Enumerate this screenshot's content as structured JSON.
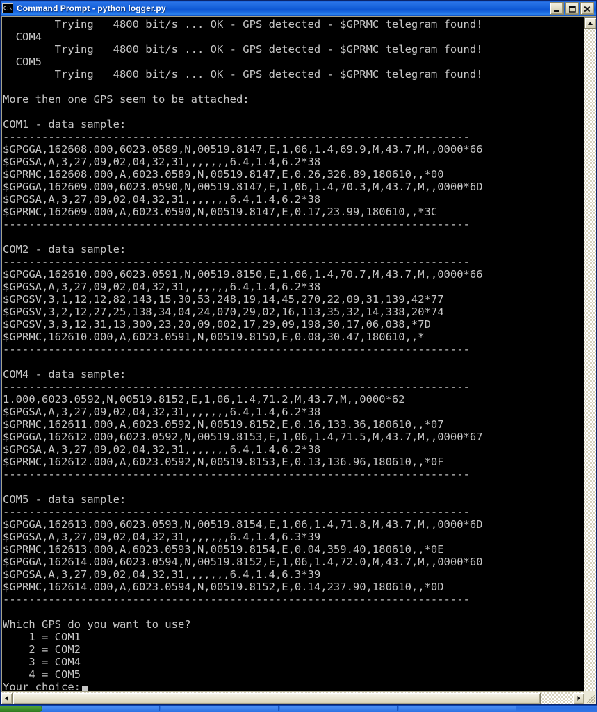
{
  "window": {
    "title": "Command Prompt - python logger.py",
    "icon_name": "cmd-console-icon",
    "icon_glyph": "C:\\",
    "minimize_label": "Minimize",
    "maximize_label": "Maximize",
    "close_label": "Close"
  },
  "scrollbars": {
    "v_up_label": "Scroll up",
    "v_down_label": "Scroll down",
    "h_left_label": "Scroll left",
    "h_right_label": "Scroll right"
  },
  "console": {
    "separator": "------------------------------------------------------------------------",
    "prompt_cursor": "block",
    "lines": [
      "        Trying   4800 bit/s ... OK - GPS detected - $GPRMC telegram found!",
      "  COM4",
      "        Trying   4800 bit/s ... OK - GPS detected - $GPRMC telegram found!",
      "  COM5",
      "        Trying   4800 bit/s ... OK - GPS detected - $GPRMC telegram found!",
      "",
      "More then one GPS seem to be attached:",
      "",
      "COM1 - data sample:",
      "------------------------------------------------------------------------",
      "$GPGGA,162608.000,6023.0589,N,00519.8147,E,1,06,1.4,69.9,M,43.7,M,,0000*66",
      "$GPGSA,A,3,27,09,02,04,32,31,,,,,,,6.4,1.4,6.2*38",
      "$GPRMC,162608.000,A,6023.0589,N,00519.8147,E,0.26,326.89,180610,,*00",
      "$GPGGA,162609.000,6023.0590,N,00519.8147,E,1,06,1.4,70.3,M,43.7,M,,0000*6D",
      "$GPGSA,A,3,27,09,02,04,32,31,,,,,,,6.4,1.4,6.2*38",
      "$GPRMC,162609.000,A,6023.0590,N,00519.8147,E,0.17,23.99,180610,,*3C",
      "------------------------------------------------------------------------",
      "",
      "COM2 - data sample:",
      "------------------------------------------------------------------------",
      "$GPGGA,162610.000,6023.0591,N,00519.8150,E,1,06,1.4,70.7,M,43.7,M,,0000*66",
      "$GPGSA,A,3,27,09,02,04,32,31,,,,,,,6.4,1.4,6.2*38",
      "$GPGSV,3,1,12,12,82,143,15,30,53,248,19,14,45,270,22,09,31,139,42*77",
      "$GPGSV,3,2,12,27,25,138,34,04,24,070,29,02,16,113,35,32,14,338,20*74",
      "$GPGSV,3,3,12,31,13,300,23,20,09,002,17,29,09,198,30,17,06,038,*7D",
      "$GPRMC,162610.000,A,6023.0591,N,00519.8150,E,0.08,30.47,180610,,*",
      "------------------------------------------------------------------------",
      "",
      "COM4 - data sample:",
      "------------------------------------------------------------------------",
      "1.000,6023.0592,N,00519.8152,E,1,06,1.4,71.2,M,43.7,M,,0000*62",
      "$GPGSA,A,3,27,09,02,04,32,31,,,,,,,6.4,1.4,6.2*38",
      "$GPRMC,162611.000,A,6023.0592,N,00519.8152,E,0.16,133.36,180610,,*07",
      "$GPGGA,162612.000,6023.0592,N,00519.8153,E,1,06,1.4,71.5,M,43.7,M,,0000*67",
      "$GPGSA,A,3,27,09,02,04,32,31,,,,,,,6.4,1.4,6.2*38",
      "$GPRMC,162612.000,A,6023.0592,N,00519.8153,E,0.13,136.96,180610,,*0F",
      "------------------------------------------------------------------------",
      "",
      "COM5 - data sample:",
      "------------------------------------------------------------------------",
      "$GPGGA,162613.000,6023.0593,N,00519.8154,E,1,06,1.4,71.8,M,43.7,M,,0000*6D",
      "$GPGSA,A,3,27,09,02,04,32,31,,,,,,,6.4,1.4,6.3*39",
      "$GPRMC,162613.000,A,6023.0593,N,00519.8154,E,0.04,359.40,180610,,*0E",
      "$GPGGA,162614.000,6023.0594,N,00519.8152,E,1,06,1.4,72.0,M,43.7,M,,0000*60",
      "$GPGSA,A,3,27,09,02,04,32,31,,,,,,,6.4,1.4,6.3*39",
      "$GPRMC,162614.000,A,6023.0594,N,00519.8152,E,0.14,237.90,180610,,*0D",
      "------------------------------------------------------------------------",
      "",
      "Which GPS do you want to use?",
      "    1 = COM1",
      "    2 = COM2",
      "    3 = COM4",
      "    4 = COM5"
    ],
    "prompt_line": "Your choice:"
  },
  "colors": {
    "console_bg": "#000000",
    "console_fg": "#c6c6c6",
    "title_bar": "#1560da",
    "window_face": "#ece9d8",
    "taskbar": "#2f74e6",
    "start_green": "#3d8c2a"
  }
}
